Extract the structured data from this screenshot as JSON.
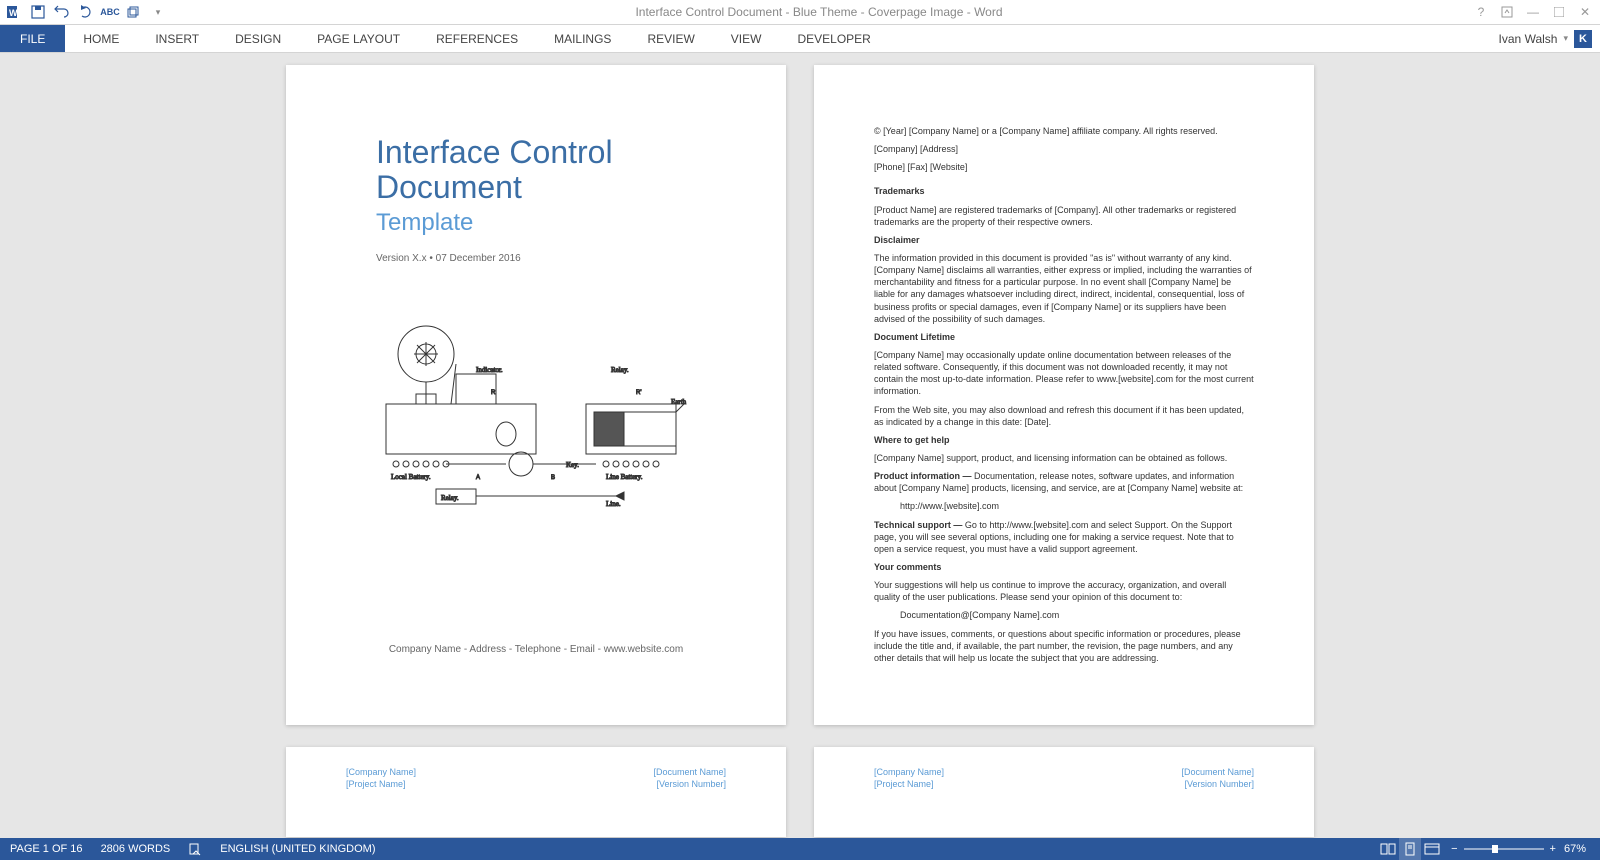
{
  "title": "Interface Control Document - Blue Theme - Coverpage Image - Word",
  "ribbon": {
    "file": "FILE",
    "tabs": [
      "HOME",
      "INSERT",
      "DESIGN",
      "PAGE LAYOUT",
      "REFERENCES",
      "MAILINGS",
      "REVIEW",
      "VIEW",
      "DEVELOPER"
    ]
  },
  "user": {
    "name": "Ivan Walsh",
    "initial": "K"
  },
  "cover": {
    "title_l1": "Interface Control",
    "title_l2": "Document",
    "subtitle": "Template",
    "version": "Version X.x • 07 December 2016",
    "footer": "Company Name - Address - Telephone - Email - www.website.com"
  },
  "legal": {
    "copyright": "© [Year] [Company Name] or a [Company Name] affiliate company. All rights reserved.",
    "addr": "[Company] [Address]",
    "contact": "[Phone] [Fax] [Website]",
    "trademarks_h": "Trademarks",
    "trademarks_p": "[Product Name] are registered trademarks of [Company]. All other trademarks or registered trademarks are the property of their respective owners.",
    "disclaimer_h": "Disclaimer",
    "disclaimer_p": "The information provided in this document is provided \"as is\" without warranty of any kind. [Company Name] disclaims all warranties, either express or implied, including the warranties of merchantability and fitness for a particular purpose. In no event shall [Company Name] be liable for any damages whatsoever including direct, indirect, incidental, consequential, loss of business profits or special damages, even if [Company Name] or its suppliers have been advised of the possibility of such damages.",
    "lifetime_h": "Document Lifetime",
    "lifetime_p1": "[Company Name] may occasionally update online documentation between releases of the related software. Consequently, if this document was not downloaded recently, it may not contain the most up-to-date information. Please refer to www.[website].com for the most current information.",
    "lifetime_p2": "From the Web site, you may also download and refresh this document if it has been updated, as indicated by a change in this date: [Date].",
    "help_h": "Where to get help",
    "help_p": "[Company Name] support, product, and licensing information can be obtained as follows.",
    "prodinfo_b": "Product information — ",
    "prodinfo_t": "Documentation, release notes, software updates, and information about [Company Name] products, licensing, and service, are at [Company Name] website at:",
    "prodinfo_url": "http://www.[website].com",
    "techsup_b": "Technical support — ",
    "techsup_t": "Go to http://www.[website].com and select Support. On the Support page, you will see several options, including one for making a service request. Note that to open a service request, you must have a valid support agreement.",
    "comments_h": "Your comments",
    "comments_p1": "Your suggestions will help us continue to improve the accuracy, organization, and overall quality of the user publications. Please send your opinion of this document to:",
    "comments_email": "Documentation@[Company Name].com",
    "comments_p2": "If you have issues, comments, or questions about specific information or procedures, please include the title and, if available, the part number, the revision, the page numbers, and any other details that will help us locate the subject that you are addressing."
  },
  "footer_fields": {
    "company": "[Company Name]",
    "project": "[Project Name]",
    "document": "[Document Name]",
    "version": "[Version Number]"
  },
  "status": {
    "page": "PAGE 1 OF 16",
    "words": "2806 WORDS",
    "lang": "ENGLISH (UNITED KINGDOM)",
    "zoom": "67%"
  }
}
